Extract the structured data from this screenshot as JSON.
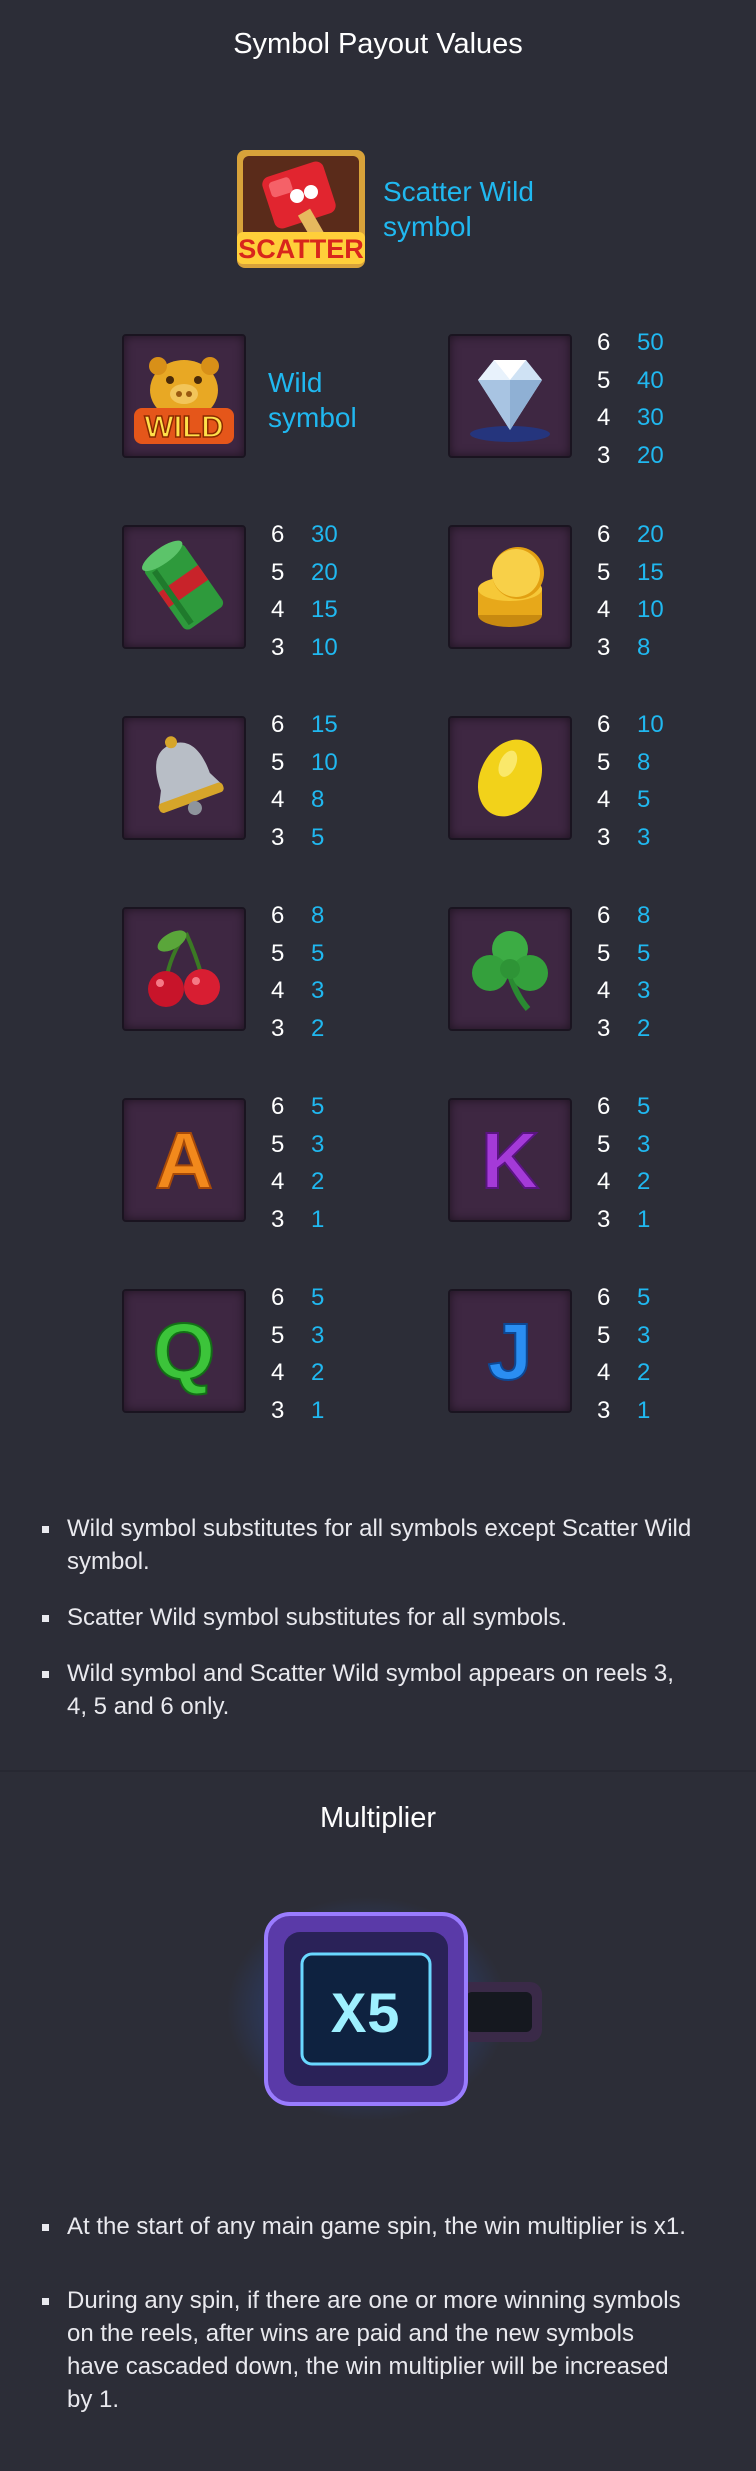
{
  "payout_section": {
    "title": "Symbol Payout Values",
    "scatter": {
      "icon": "scatter-hammer-icon",
      "label_line1": "Scatter Wild",
      "label_line2": "symbol"
    },
    "wild": {
      "icon": "wild-pig-icon",
      "label_line1": "Wild",
      "label_line2": "symbol"
    },
    "symbols": [
      {
        "icon": "diamond-icon",
        "payouts": [
          {
            "count": "6",
            "value": "50"
          },
          {
            "count": "5",
            "value": "40"
          },
          {
            "count": "4",
            "value": "30"
          },
          {
            "count": "3",
            "value": "20"
          }
        ]
      },
      {
        "icon": "cash-roll-icon",
        "payouts": [
          {
            "count": "6",
            "value": "30"
          },
          {
            "count": "5",
            "value": "20"
          },
          {
            "count": "4",
            "value": "15"
          },
          {
            "count": "3",
            "value": "10"
          }
        ]
      },
      {
        "icon": "gold-coins-icon",
        "payouts": [
          {
            "count": "6",
            "value": "20"
          },
          {
            "count": "5",
            "value": "15"
          },
          {
            "count": "4",
            "value": "10"
          },
          {
            "count": "3",
            "value": "8"
          }
        ]
      },
      {
        "icon": "bell-icon",
        "payouts": [
          {
            "count": "6",
            "value": "15"
          },
          {
            "count": "5",
            "value": "10"
          },
          {
            "count": "4",
            "value": "8"
          },
          {
            "count": "3",
            "value": "5"
          }
        ]
      },
      {
        "icon": "lemon-icon",
        "payouts": [
          {
            "count": "6",
            "value": "10"
          },
          {
            "count": "5",
            "value": "8"
          },
          {
            "count": "4",
            "value": "5"
          },
          {
            "count": "3",
            "value": "3"
          }
        ]
      },
      {
        "icon": "cherry-icon",
        "payouts": [
          {
            "count": "6",
            "value": "8"
          },
          {
            "count": "5",
            "value": "5"
          },
          {
            "count": "4",
            "value": "3"
          },
          {
            "count": "3",
            "value": "2"
          }
        ]
      },
      {
        "icon": "clover-icon",
        "payouts": [
          {
            "count": "6",
            "value": "8"
          },
          {
            "count": "5",
            "value": "5"
          },
          {
            "count": "4",
            "value": "3"
          },
          {
            "count": "3",
            "value": "2"
          }
        ]
      },
      {
        "icon": "letter-a-icon",
        "letter": "A",
        "payouts": [
          {
            "count": "6",
            "value": "5"
          },
          {
            "count": "5",
            "value": "3"
          },
          {
            "count": "4",
            "value": "2"
          },
          {
            "count": "3",
            "value": "1"
          }
        ]
      },
      {
        "icon": "letter-k-icon",
        "letter": "K",
        "payouts": [
          {
            "count": "6",
            "value": "5"
          },
          {
            "count": "5",
            "value": "3"
          },
          {
            "count": "4",
            "value": "2"
          },
          {
            "count": "3",
            "value": "1"
          }
        ]
      },
      {
        "icon": "letter-q-icon",
        "letter": "Q",
        "payouts": [
          {
            "count": "6",
            "value": "5"
          },
          {
            "count": "5",
            "value": "3"
          },
          {
            "count": "4",
            "value": "2"
          },
          {
            "count": "3",
            "value": "1"
          }
        ]
      },
      {
        "icon": "letter-j-icon",
        "letter": "J",
        "payouts": [
          {
            "count": "6",
            "value": "5"
          },
          {
            "count": "5",
            "value": "3"
          },
          {
            "count": "4",
            "value": "2"
          },
          {
            "count": "3",
            "value": "1"
          }
        ]
      }
    ],
    "rules": [
      "Wild symbol substitutes for all symbols except Scatter Wild symbol.",
      "Scatter Wild symbol substitutes for all symbols.",
      "Wild symbol and Scatter Wild symbol appears on reels 3, 4, 5 and 6 only."
    ]
  },
  "multiplier_section": {
    "title": "Multiplier",
    "display_text": "X5",
    "icon": "multiplier-display-icon",
    "rules": [
      "At the start of any main game spin, the win multiplier is x1.",
      "During any spin, if there are one or more winning symbols on the reels, after wins are paid and the new symbols have cascaded down, the win multiplier will be increased by 1."
    ]
  },
  "colors": {
    "background": "#2c2d37",
    "accent_blue": "#20b8f0",
    "tile_bg": "#3e2742"
  }
}
